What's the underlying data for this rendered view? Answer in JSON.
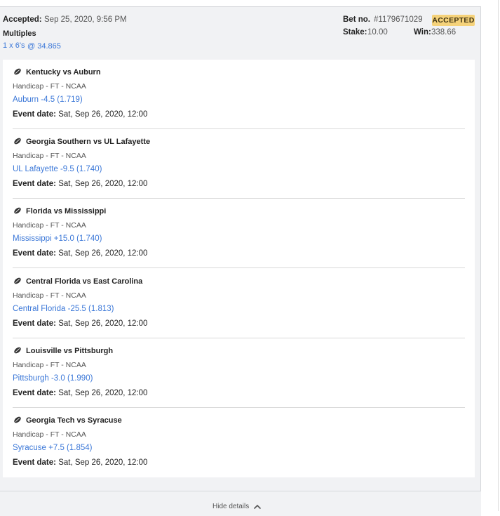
{
  "bet": {
    "accepted_label": "Accepted:",
    "accepted_value": "Sep 25, 2020, 9:56 PM",
    "type": "Multiples",
    "combo_link": "1 x 6's",
    "combo_odds": "@ 34.865",
    "bet_no_label": "Bet no.",
    "bet_no_value": "#1179671029",
    "status": "ACCEPTED",
    "stake_label": "Stake:",
    "stake_value": "10.00",
    "win_label": "Win:",
    "win_value": "338.66"
  },
  "legs": [
    {
      "title": "Kentucky vs Auburn",
      "market": "Handicap - FT - NCAA",
      "pick": "Auburn -4.5 (1.719)",
      "date_label": "Event date:",
      "date_value": "Sat, Sep 26, 2020, 12:00"
    },
    {
      "title": "Georgia Southern vs UL Lafayette",
      "market": "Handicap - FT - NCAA",
      "pick": "UL Lafayette -9.5 (1.740)",
      "date_label": "Event date:",
      "date_value": "Sat, Sep 26, 2020, 12:00"
    },
    {
      "title": "Florida vs Mississippi",
      "market": "Handicap - FT - NCAA",
      "pick": "Mississippi +15.0 (1.740)",
      "date_label": "Event date:",
      "date_value": "Sat, Sep 26, 2020, 12:00"
    },
    {
      "title": "Central Florida vs East Carolina",
      "market": "Handicap - FT - NCAA",
      "pick": "Central Florida -25.5 (1.813)",
      "date_label": "Event date:",
      "date_value": "Sat, Sep 26, 2020, 12:00"
    },
    {
      "title": "Louisville vs Pittsburgh",
      "market": "Handicap - FT - NCAA",
      "pick": "Pittsburgh -3.0 (1.990)",
      "date_label": "Event date:",
      "date_value": "Sat, Sep 26, 2020, 12:00"
    },
    {
      "title": "Georgia Tech vs Syracuse",
      "market": "Handicap - FT - NCAA",
      "pick": "Syracuse +7.5 (1.854)",
      "date_label": "Event date:",
      "date_value": "Sat, Sep 26, 2020, 12:00"
    }
  ],
  "footer": {
    "hide_label": "Hide details"
  },
  "icons": {
    "sport": "american-football-icon",
    "toggle": "chevron-up-icon"
  },
  "colors": {
    "link": "#3c78d8",
    "badge": "#f5d27a",
    "panel": "#f1f2f4"
  }
}
